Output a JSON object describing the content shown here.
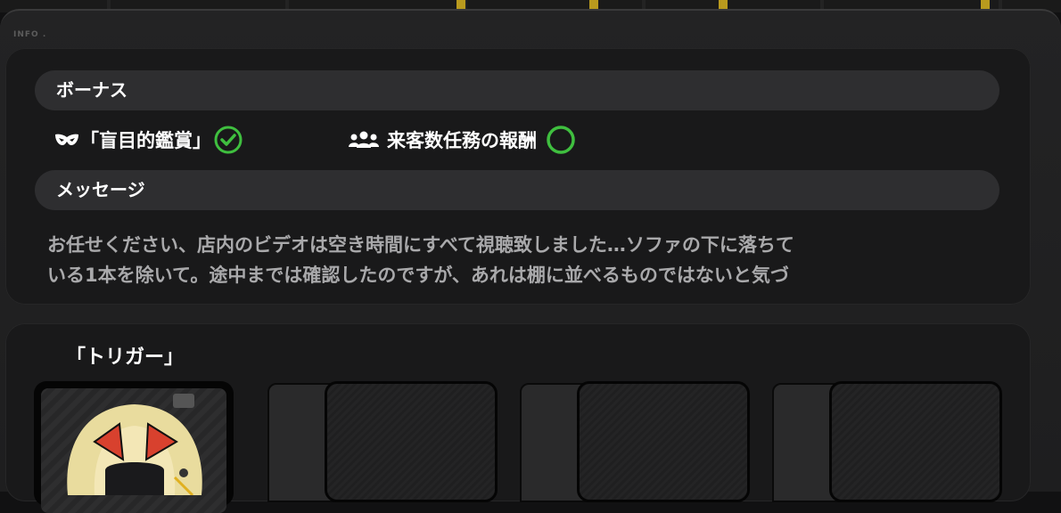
{
  "panel": {
    "info_label": "INFO ."
  },
  "bonus": {
    "heading": "ボーナス",
    "items": [
      {
        "label": "「盲目的鑑賞」",
        "icon": "mask-icon",
        "status": "completed"
      },
      {
        "label": "来客数任務の報酬",
        "icon": "group-icon",
        "status": "incomplete"
      }
    ]
  },
  "message": {
    "heading": "メッセージ",
    "lines": [
      "お任せください、店内のビデオは空き時間にすべて視聴致しました…ソファの下に落ちて",
      "いる1本を除いて。途中までは確認したのですが、あれは棚に並べるものではないと気づ"
    ]
  },
  "trigger": {
    "title": "「トリガー」",
    "slots": [
      {
        "state": "character"
      },
      {
        "state": "locked"
      },
      {
        "state": "locked"
      },
      {
        "state": "locked"
      }
    ]
  },
  "colors": {
    "check_green": "#3fbf3f",
    "accent_yellow": "#b99a1e"
  }
}
